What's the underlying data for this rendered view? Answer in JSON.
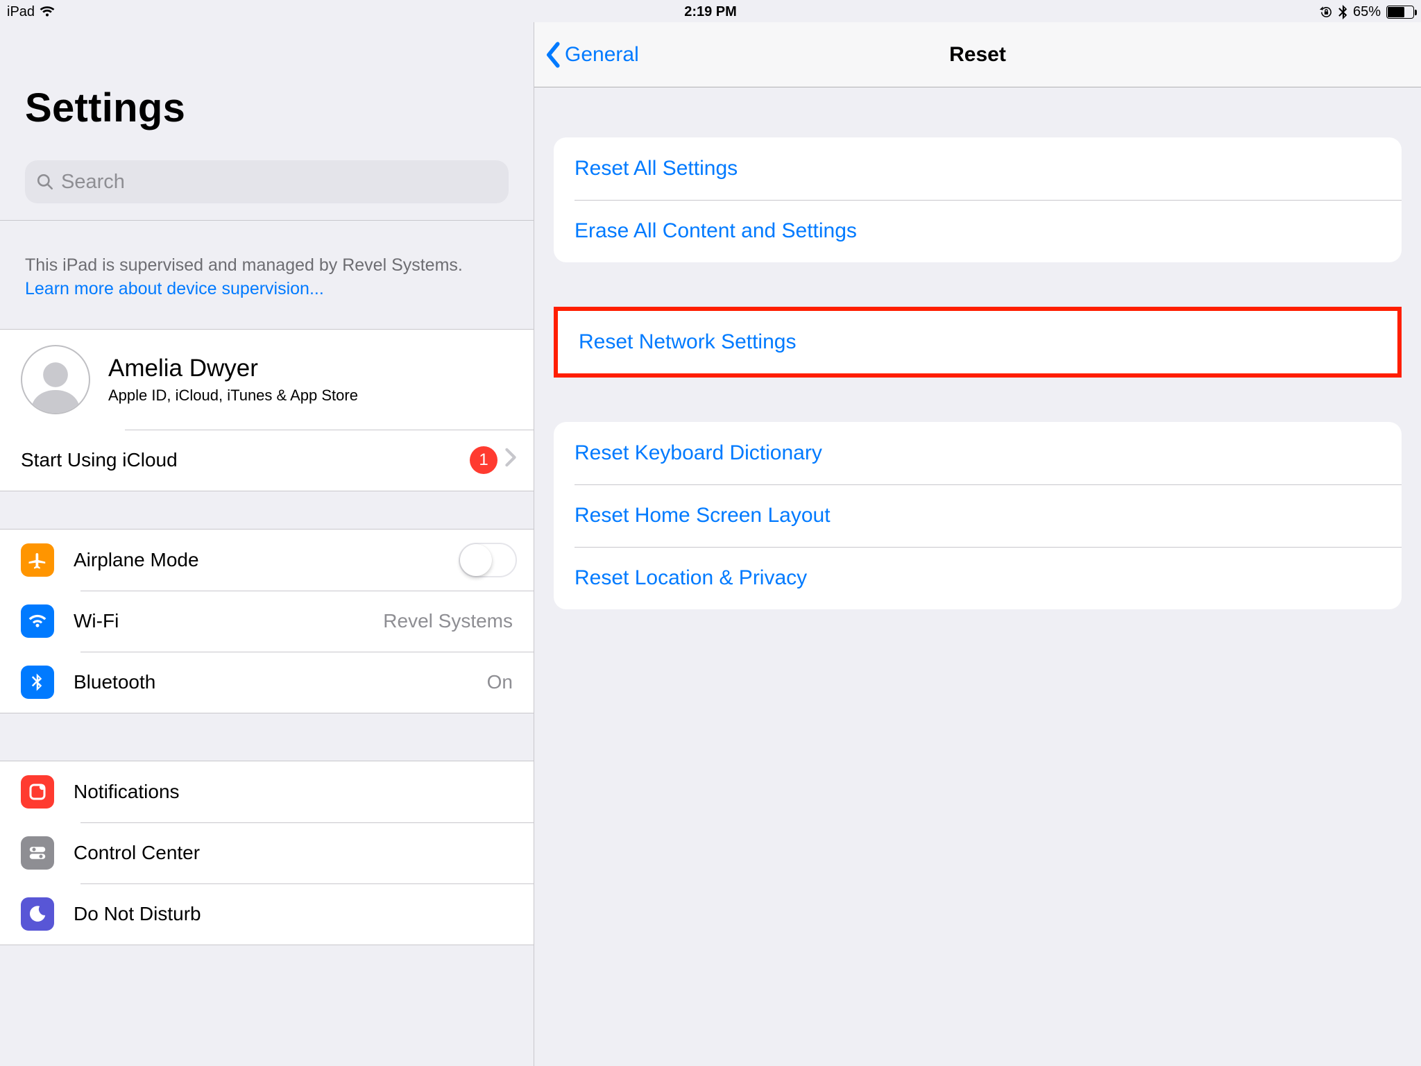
{
  "status": {
    "device": "iPad",
    "time": "2:19 PM",
    "battery_pct": "65%"
  },
  "sidebar": {
    "title": "Settings",
    "search_placeholder": "Search",
    "supervision_text": "This iPad is supervised and managed by Revel Systems.",
    "supervision_link": "Learn more about device supervision...",
    "profile": {
      "name": "Amelia Dwyer",
      "sub": "Apple ID, iCloud, iTunes & App Store"
    },
    "icloud": {
      "label": "Start Using iCloud",
      "badge": "1"
    },
    "items": {
      "airplane": {
        "label": "Airplane Mode"
      },
      "wifi": {
        "label": "Wi-Fi",
        "value": "Revel Systems"
      },
      "bluetooth": {
        "label": "Bluetooth",
        "value": "On"
      },
      "notif": {
        "label": "Notifications"
      },
      "cc": {
        "label": "Control Center"
      },
      "dnd": {
        "label": "Do Not Disturb"
      }
    }
  },
  "detail": {
    "back": "General",
    "title": "Reset",
    "g1": {
      "reset_all": "Reset All Settings",
      "erase_all": "Erase All Content and Settings"
    },
    "g2": {
      "reset_net": "Reset Network Settings"
    },
    "g3": {
      "reset_kb": "Reset Keyboard Dictionary",
      "reset_home": "Reset Home Screen Layout",
      "reset_loc": "Reset Location & Privacy"
    }
  }
}
